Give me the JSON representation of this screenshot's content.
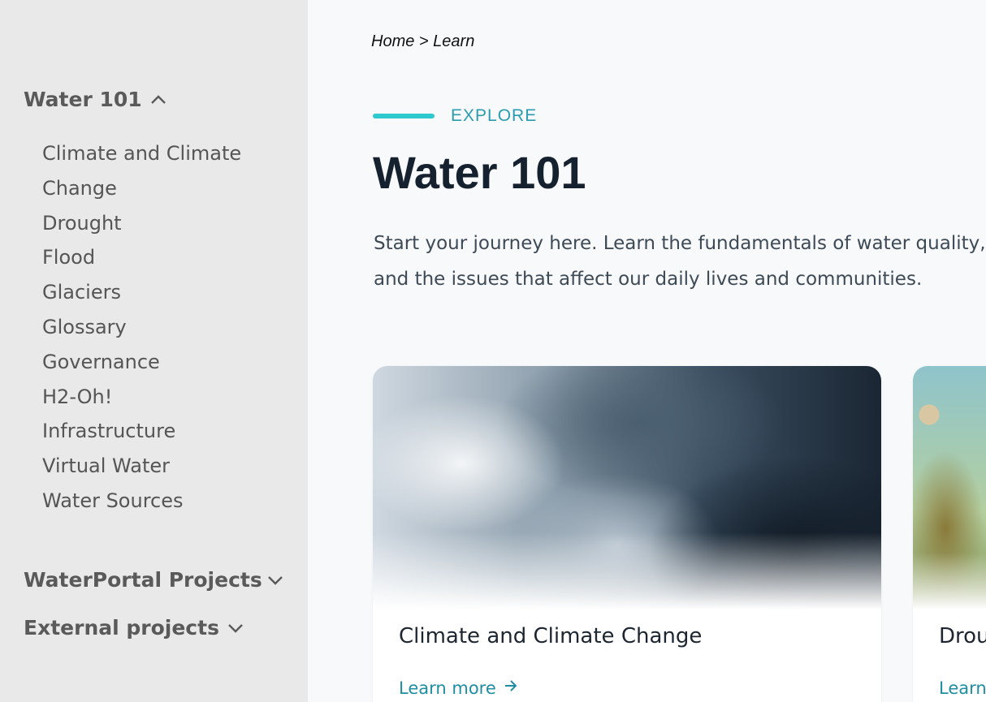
{
  "sidebar": {
    "section_water101": {
      "label": "Water 101",
      "items": [
        "Climate and Climate Change",
        "Drought",
        "Flood",
        "Glaciers",
        "Glossary",
        "Governance",
        "H2-Oh!",
        "Infrastructure",
        "Virtual Water",
        "Water Sources"
      ]
    },
    "section_waterportal": {
      "label": "WaterPortal Projects"
    },
    "section_external": {
      "label": "External projects"
    }
  },
  "breadcrumb": {
    "home": "Home",
    "separator": ">",
    "current": "Learn"
  },
  "eyebrow": "EXPLORE",
  "page_title": "Water 101",
  "intro": "Start your journey here. Learn the fundamentals of water quality, quantity, and the issues that affect our daily lives and communities.",
  "cards": [
    {
      "title": "Climate and Climate Change",
      "cta": "Learn more",
      "image": "storm-clouds"
    },
    {
      "title": "Drought",
      "cta": "Learn more",
      "image": "dry-plants"
    }
  ],
  "icons": {
    "expanded": "chevron-up-icon",
    "collapsed": "chevron-down-icon",
    "cta": "arrow-right-icon"
  },
  "colors": {
    "sidebar_bg": "#e9e9e9",
    "page_bg": "#f7f9fb",
    "accent_bar": "#2ec8cf",
    "accent_text": "#2b9cb0",
    "link": "#1f8ea3",
    "title": "#16212f"
  }
}
